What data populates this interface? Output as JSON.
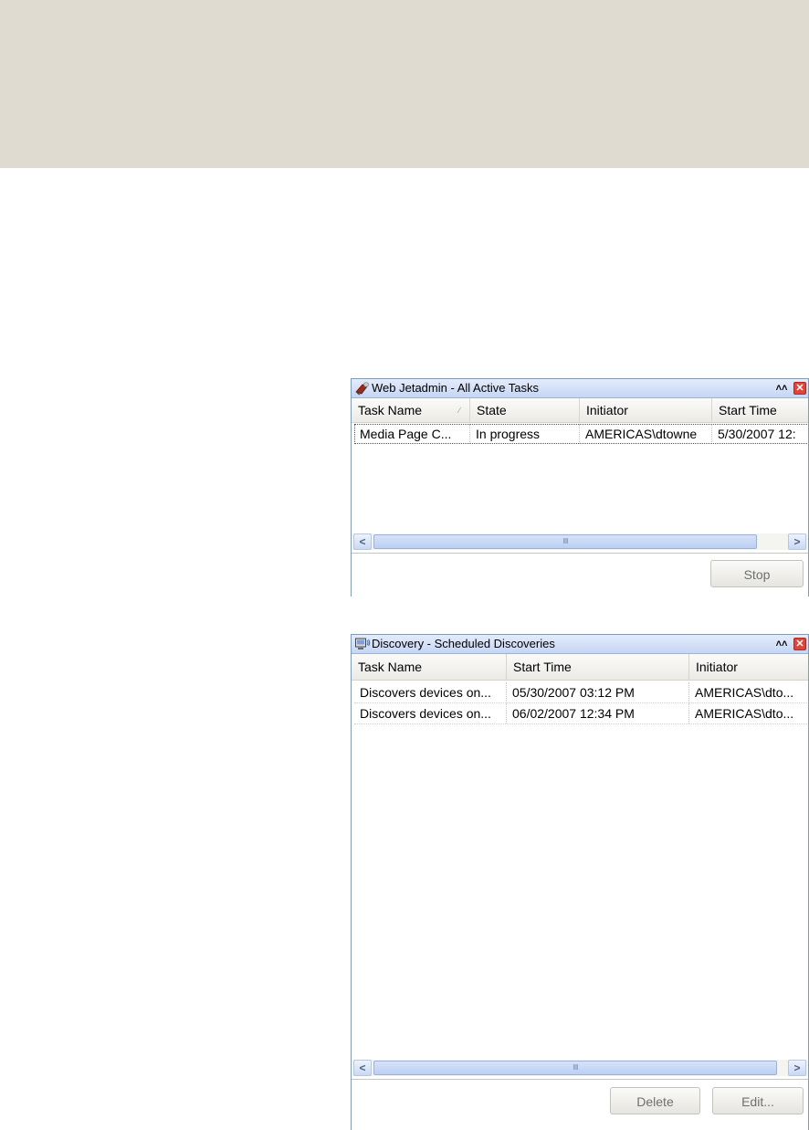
{
  "active_tasks": {
    "title": "Web Jetadmin - All Active Tasks",
    "columns": [
      "Task Name",
      "State",
      "Initiator",
      "Start Time"
    ],
    "rows": [
      [
        "Media Page C...",
        "In progress",
        "AMERICAS\\dtowne",
        "5/30/2007  12:"
      ]
    ],
    "stop_label": "Stop",
    "icon": "jetadmin-app-icon"
  },
  "scheduled_discoveries": {
    "title": "Discovery - Scheduled Discoveries",
    "columns": [
      "Task Name",
      "Start Time",
      "Initiator"
    ],
    "rows": [
      [
        "Discovers devices on...",
        "05/30/2007 03:12 PM",
        "AMERICAS\\dto..."
      ],
      [
        "Discovers devices on...",
        "06/02/2007 12:34 PM",
        "AMERICAS\\dto..."
      ]
    ],
    "delete_label": "Delete",
    "edit_label": "Edit...",
    "icon": "discovery-icon"
  },
  "glyphs": {
    "collapse": "˄˄",
    "close": "✕",
    "scroll_left": "<",
    "scroll_right": ">",
    "grip": "IIII",
    "sort": "∕"
  }
}
